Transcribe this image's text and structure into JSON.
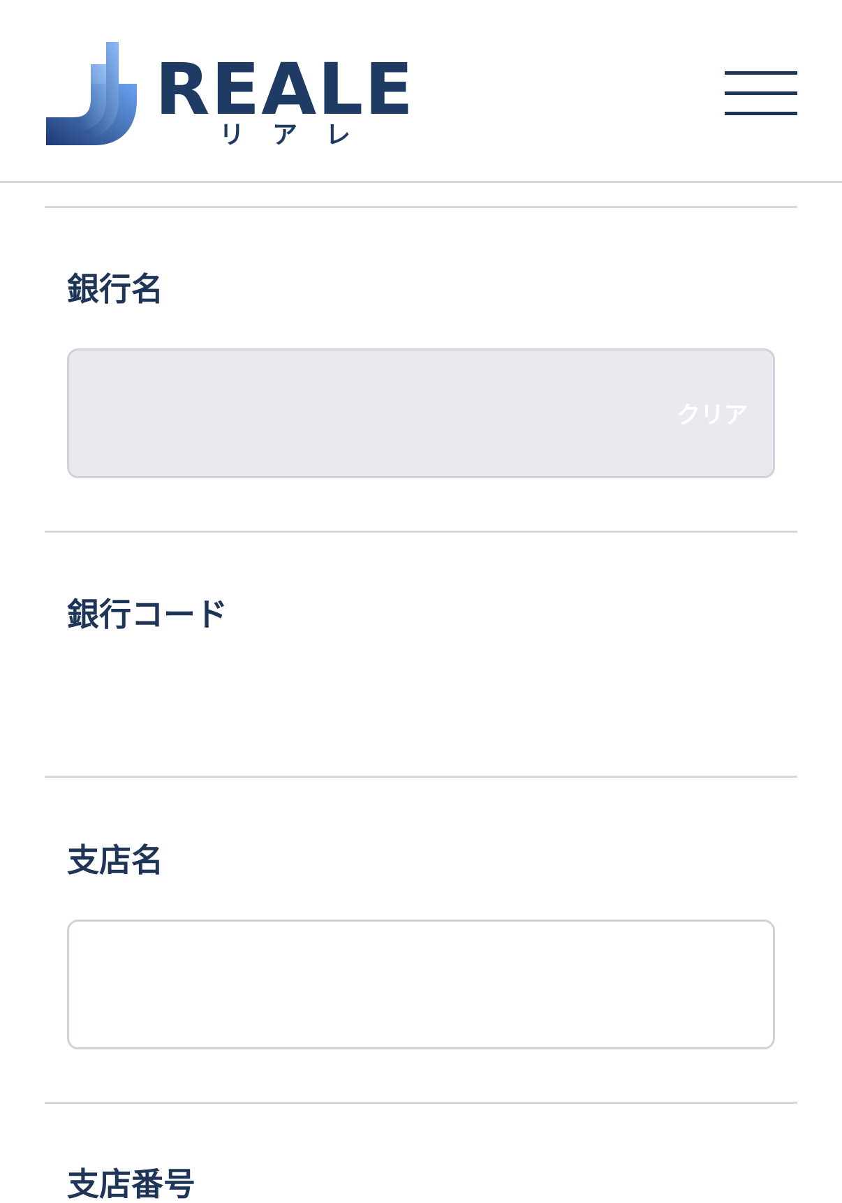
{
  "header": {
    "logo_word": "REALE",
    "logo_kana": "リアレ",
    "menu_icon": "hamburger-menu-icon"
  },
  "form": {
    "bank_name": {
      "label": "銀行名",
      "value": "",
      "clear_label": "クリア"
    },
    "bank_code": {
      "label": "銀行コード",
      "value": ""
    },
    "branch_name": {
      "label": "支店名",
      "value": ""
    },
    "branch_number": {
      "label": "支店番号"
    }
  },
  "colors": {
    "brand_navy": "#1f3a63",
    "text": "#1f3558",
    "divider": "#d5d9df",
    "disabled_input_bg": "#e9eaee",
    "logo_blue_light": "#6aa3f0",
    "logo_blue_dark": "#1d3a73"
  }
}
